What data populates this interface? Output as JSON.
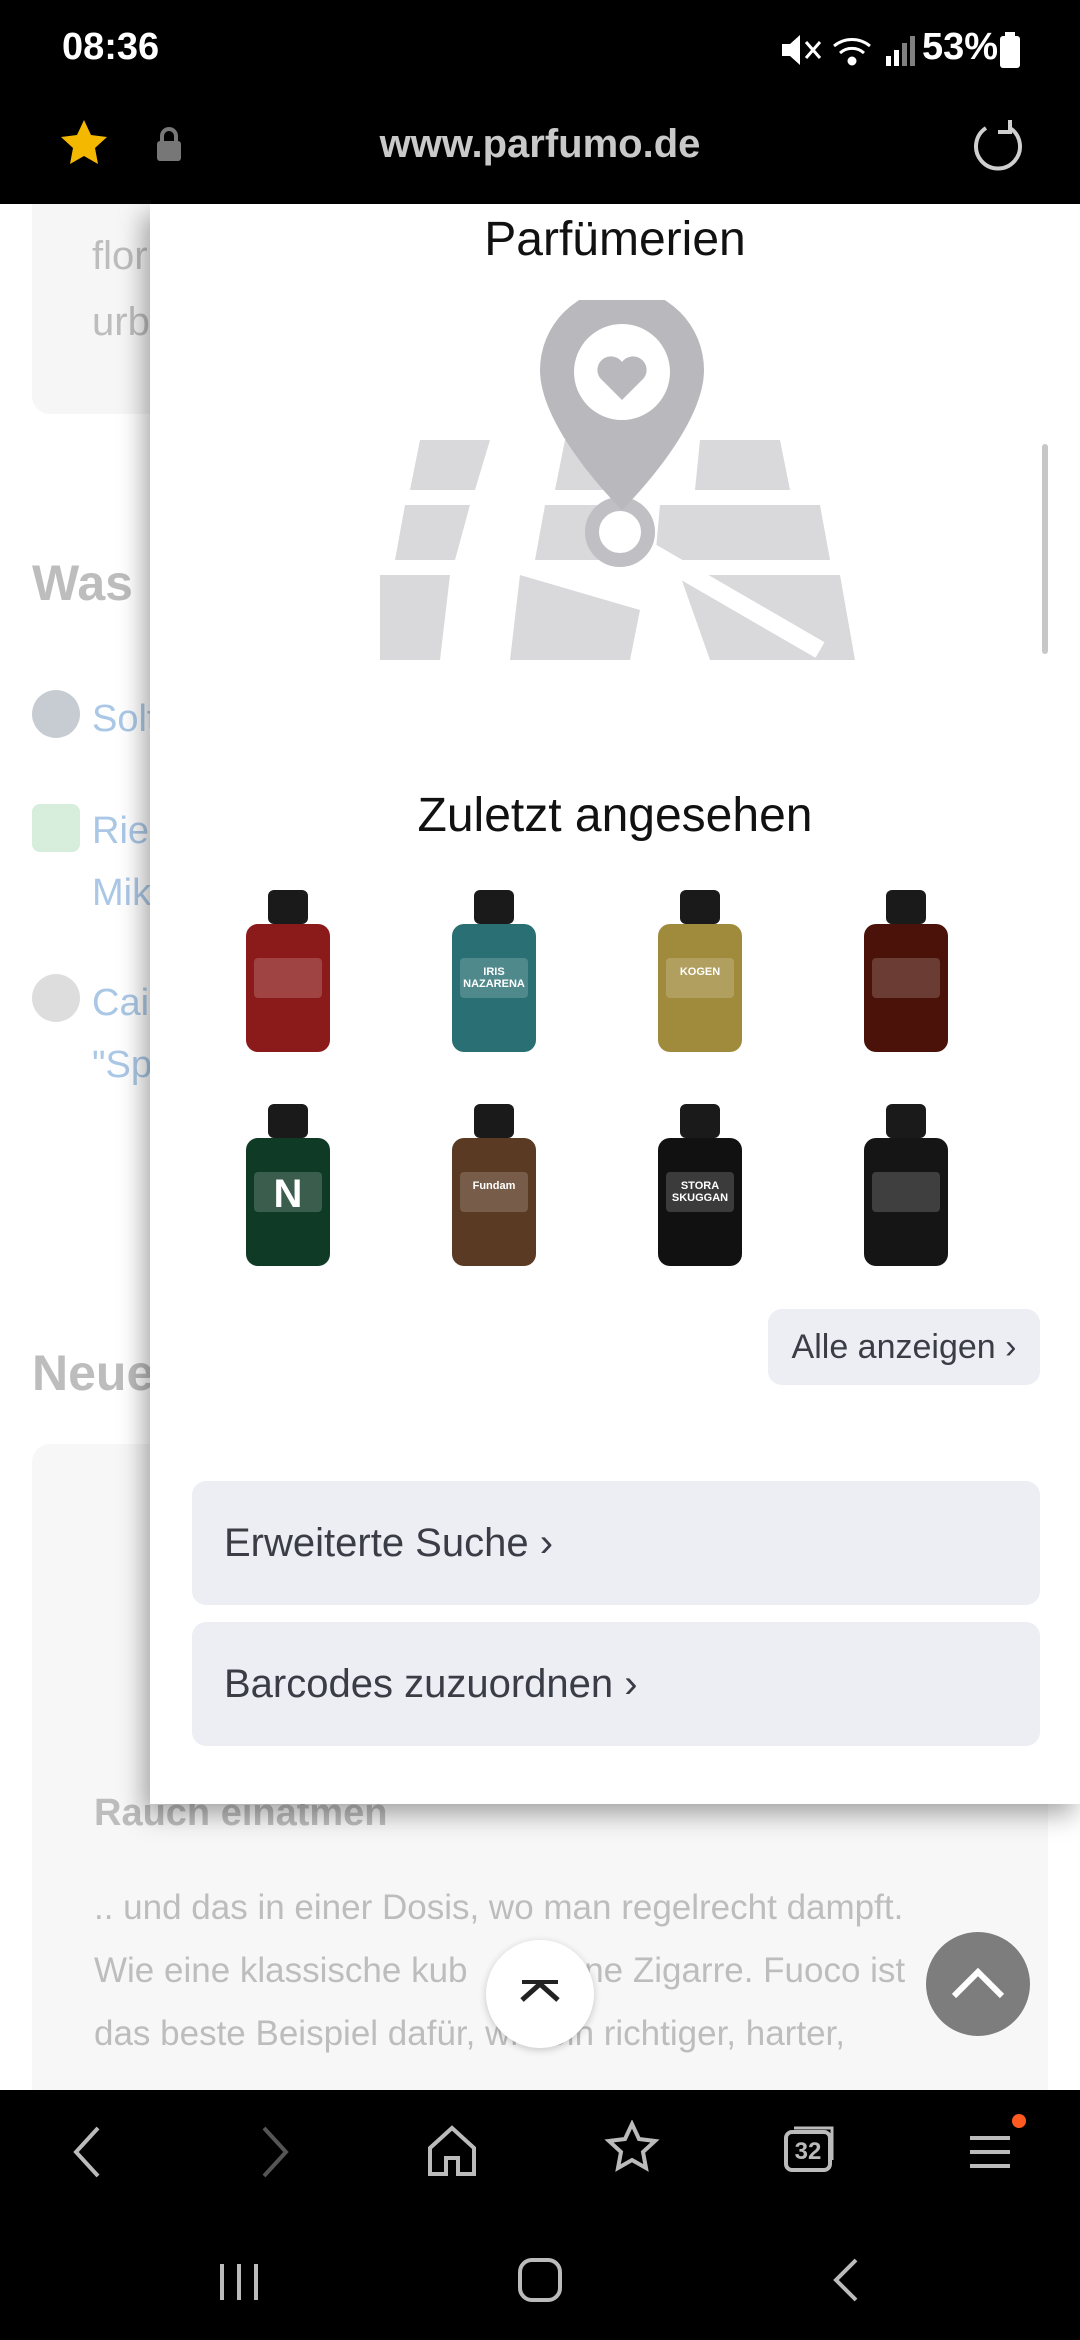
{
  "status_bar": {
    "time": "08:36",
    "battery": "53%"
  },
  "browser": {
    "url": "www.parfumo.de",
    "tab_count": "32"
  },
  "background_page": {
    "snippets": [
      "flor",
      "urb"
    ],
    "heading_was": "Was",
    "users": [
      "Solt",
      "Rie",
      "Mik",
      "Cai",
      "\"Sp"
    ],
    "heading_neue": "Neue",
    "review_title": "Rauch einatmen",
    "review_lines": [
      ".. und das in einer Dosis, wo man regelrecht dampft.",
      "Wie eine klassische kub            ne Zigarre. Fuoco ist",
      "das beste Beispiel dafür, wie ein richtiger, harter,"
    ]
  },
  "panel": {
    "stores_title": "Parfümerien",
    "recent_title": "Zuletzt angesehen",
    "show_all": "Alle anzeigen ›",
    "advanced_search": "Erweiterte Suche ›",
    "assign_barcodes": "Barcodes zuzuordnen ›",
    "bottles": [
      {
        "label": "",
        "color": "#8b1a1a"
      },
      {
        "label": "IRIS NAZARENA",
        "color": "#2a6f73"
      },
      {
        "label": "KOGEN",
        "color": "#a08a3c"
      },
      {
        "label": "",
        "color": "#4a1208"
      },
      {
        "label": "N",
        "color": "#0f3a26"
      },
      {
        "label": "Fundam",
        "color": "#5a3a22"
      },
      {
        "label": "STORA SKUGGAN",
        "color": "#111111"
      },
      {
        "label": "",
        "color": "#151515"
      }
    ]
  },
  "colors": {
    "accent_star": "#f5b800",
    "notification_dot": "#ff5a1f"
  }
}
